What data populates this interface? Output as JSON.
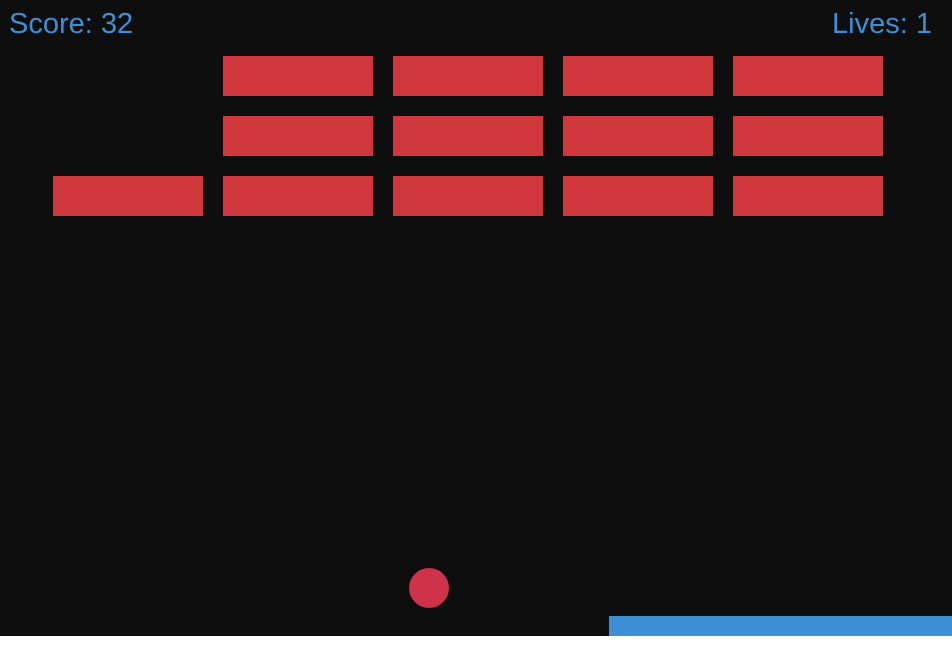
{
  "hud": {
    "score_text": "Score: 32",
    "lives_text": "Lives: 1"
  },
  "game_state": {
    "score": 32,
    "lives": 1
  },
  "bricks": {
    "rows": [
      [
        false,
        true,
        true,
        true,
        true
      ],
      [
        false,
        true,
        true,
        true,
        true
      ],
      [
        true,
        true,
        true,
        true,
        true
      ]
    ]
  },
  "colors": {
    "background": "#0e0e0e",
    "hud_text": "#3d8fd6",
    "brick": "#cf373c",
    "ball": "#d0324a",
    "paddle": "#3d8fd6"
  }
}
